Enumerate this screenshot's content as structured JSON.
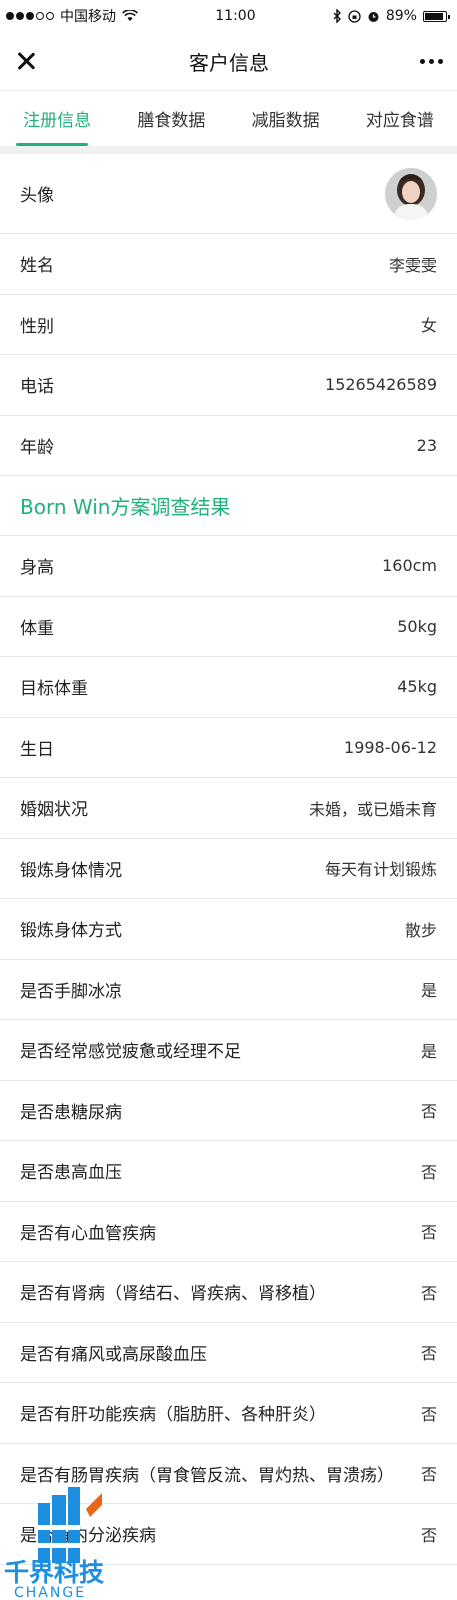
{
  "status_bar": {
    "carrier": "中国移动",
    "time": "11:00",
    "battery": "89%",
    "battery_fraction": 0.89
  },
  "navbar": {
    "title": "客户信息"
  },
  "tabs": [
    {
      "label": "注册信息"
    },
    {
      "label": "膳食数据"
    },
    {
      "label": "减脂数据"
    },
    {
      "label": "对应食谱"
    }
  ],
  "basic": {
    "avatar_label": "头像",
    "rows": [
      {
        "label": "姓名",
        "value": "李雯雯"
      },
      {
        "label": "性别",
        "value": "女"
      },
      {
        "label": "电话",
        "value": "15265426589"
      },
      {
        "label": "年龄",
        "value": "23"
      }
    ]
  },
  "survey": {
    "title": "Born  Win方案调查结果",
    "rows": [
      {
        "label": "身高",
        "value": "160cm"
      },
      {
        "label": "体重",
        "value": "50kg"
      },
      {
        "label": "目标体重",
        "value": "45kg"
      },
      {
        "label": "生日",
        "value": "1998-06-12"
      },
      {
        "label": "婚姻状况",
        "value": "未婚，或已婚未育"
      },
      {
        "label": "锻炼身体情况",
        "value": "每天有计划锻炼"
      },
      {
        "label": "锻炼身体方式",
        "value": "散步"
      },
      {
        "label": "是否手脚冰凉",
        "value": "是"
      },
      {
        "label": "是否经常感觉疲惫或经理不足",
        "value": "是"
      },
      {
        "label": "是否患糖尿病",
        "value": "否"
      },
      {
        "label": "是否患高血压",
        "value": "否"
      },
      {
        "label": "是否有心血管疾病",
        "value": "否"
      },
      {
        "label": "是否有肾病（肾结石、肾疾病、肾移植）",
        "value": "否"
      },
      {
        "label": "是否有痛风或高尿酸血压",
        "value": "否"
      },
      {
        "label": "是否有肝功能疾病（脂肪肝、各种肝炎）",
        "value": "否"
      },
      {
        "label": "是否有肠胃疾病（胃食管反流、胃灼热、胃溃疡）",
        "value": "否"
      },
      {
        "label": "是否有内分泌疾病",
        "value": "否"
      }
    ]
  },
  "watermark": {
    "text_cn": "千界科技",
    "text_en": "CHANGE"
  },
  "colors": {
    "accent": "#1fb27a",
    "watermark_blue": "#1e8fe0"
  },
  "icons": [
    "close-icon",
    "more-icon",
    "wifi-icon",
    "bluetooth-icon",
    "alarm-icon",
    "battery-icon"
  ]
}
